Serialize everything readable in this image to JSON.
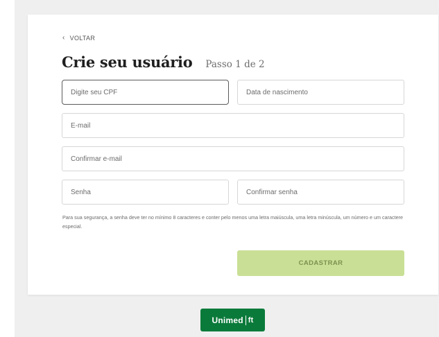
{
  "back_label": "VOLTAR",
  "title": "Crie seu usuário",
  "step": "Passo 1 de 2",
  "fields": {
    "cpf": {
      "placeholder": "Digite seu CPF"
    },
    "birth": {
      "placeholder": "Data de nascimento"
    },
    "email": {
      "placeholder": "E-mail"
    },
    "confirm_email": {
      "placeholder": "Confirmar e-mail"
    },
    "password": {
      "placeholder": "Senha"
    },
    "confirm_password": {
      "placeholder": "Confirmar senha"
    }
  },
  "password_hint": "Para sua segurança, a senha deve ter no mínimo 8 caracteres e conter pelo menos uma letra maiúscula, uma letra minúscula, um número e um caractere especial.",
  "submit_label": "CADASTRAR",
  "logo": {
    "text": "Unimed",
    "glyph": "ft"
  },
  "colors": {
    "submit_bg": "#c9df95",
    "submit_text": "#7d9150",
    "brand_green": "#0a7a3a"
  }
}
